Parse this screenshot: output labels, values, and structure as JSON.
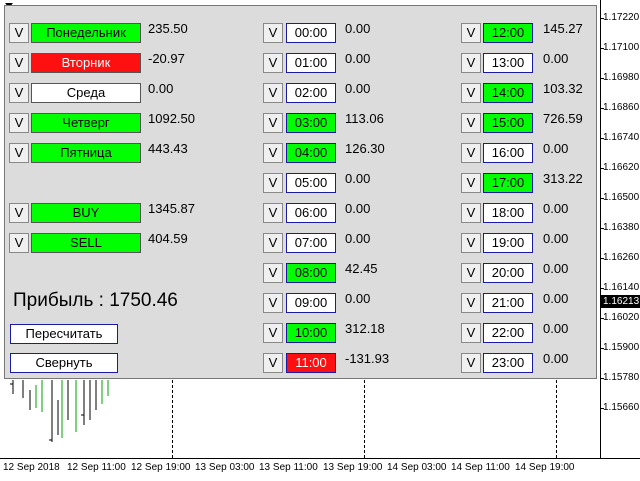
{
  "days": [
    {
      "label": "Понедельник",
      "value": "235.50",
      "state": "green"
    },
    {
      "label": "Вторник",
      "value": "-20.97",
      "state": "red"
    },
    {
      "label": "Среда",
      "value": "0.00",
      "state": "white"
    },
    {
      "label": "Четверг",
      "value": "1092.50",
      "state": "green"
    },
    {
      "label": "Пятница",
      "value": "443.43",
      "state": "green"
    }
  ],
  "trades": [
    {
      "label": "BUY",
      "value": "1345.87",
      "state": "green"
    },
    {
      "label": "SELL",
      "value": "404.59",
      "state": "green"
    }
  ],
  "toggle_label": "V",
  "hours_left": [
    {
      "label": "00:00",
      "value": "0.00",
      "state": "white"
    },
    {
      "label": "01:00",
      "value": "0.00",
      "state": "white"
    },
    {
      "label": "02:00",
      "value": "0.00",
      "state": "white"
    },
    {
      "label": "03:00",
      "value": "113.06",
      "state": "green"
    },
    {
      "label": "04:00",
      "value": "126.30",
      "state": "green"
    },
    {
      "label": "05:00",
      "value": "0.00",
      "state": "white"
    },
    {
      "label": "06:00",
      "value": "0.00",
      "state": "white"
    },
    {
      "label": "07:00",
      "value": "0.00",
      "state": "white"
    },
    {
      "label": "08:00",
      "value": "42.45",
      "state": "green"
    },
    {
      "label": "09:00",
      "value": "0.00",
      "state": "white"
    },
    {
      "label": "10:00",
      "value": "312.18",
      "state": "green"
    },
    {
      "label": "11:00",
      "value": "-131.93",
      "state": "red"
    }
  ],
  "hours_right": [
    {
      "label": "12:00",
      "value": "145.27",
      "state": "green"
    },
    {
      "label": "13:00",
      "value": "0.00",
      "state": "white"
    },
    {
      "label": "14:00",
      "value": "103.32",
      "state": "green"
    },
    {
      "label": "15:00",
      "value": "726.59",
      "state": "green"
    },
    {
      "label": "16:00",
      "value": "0.00",
      "state": "white"
    },
    {
      "label": "17:00",
      "value": "313.22",
      "state": "green"
    },
    {
      "label": "18:00",
      "value": "0.00",
      "state": "white"
    },
    {
      "label": "19:00",
      "value": "0.00",
      "state": "white"
    },
    {
      "label": "20:00",
      "value": "0.00",
      "state": "white"
    },
    {
      "label": "21:00",
      "value": "0.00",
      "state": "white"
    },
    {
      "label": "22:00",
      "value": "0.00",
      "state": "white"
    },
    {
      "label": "23:00",
      "value": "0.00",
      "state": "white"
    }
  ],
  "profit_label": "Прибыль : 1750.46",
  "buttons": {
    "recalc": "Пересчитать",
    "collapse": "Свернуть"
  },
  "price_axis": [
    "1.17220",
    "1.17100",
    "1.16980",
    "1.16860",
    "1.16740",
    "1.16620",
    "1.16500",
    "1.16380",
    "1.16260",
    "1.16140",
    "1.16020",
    "1.15900",
    "1.15780",
    "1.15660"
  ],
  "current_price": "1.16213",
  "time_axis": [
    "12 Sep 2018",
    "12 Sep 11:00",
    "12 Sep 19:00",
    "13 Sep 03:00",
    "13 Sep 11:00",
    "13 Sep 19:00",
    "14 Sep 03:00",
    "14 Sep 11:00",
    "14 Sep 19:00"
  ],
  "colors": {
    "green": "#00ff00",
    "red": "#ff1010",
    "white": "#ffffff",
    "panel": "#dcdcdc"
  }
}
